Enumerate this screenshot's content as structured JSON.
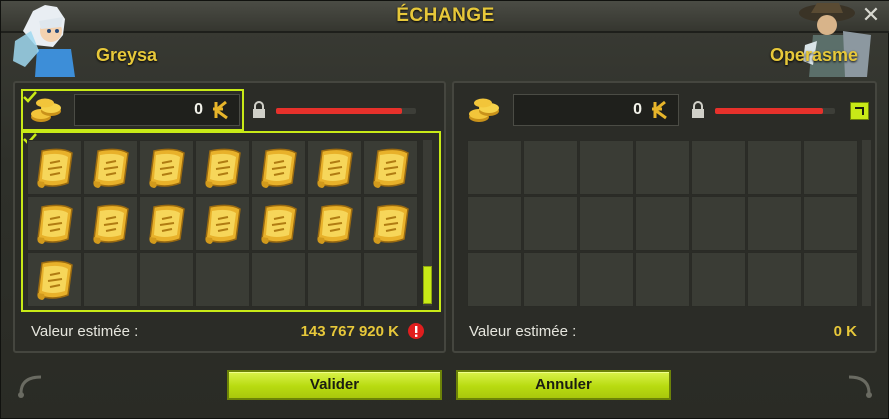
{
  "window": {
    "title": "ÉCHANGE",
    "close_label": "✕"
  },
  "left": {
    "player_name": "Greysa",
    "kamas": "0",
    "lock_progress": 0.9,
    "items": [
      {
        "icon": "scroll-icon"
      },
      {
        "icon": "scroll-icon"
      },
      {
        "icon": "scroll-icon"
      },
      {
        "icon": "scroll-icon"
      },
      {
        "icon": "scroll-icon"
      },
      {
        "icon": "scroll-icon"
      },
      {
        "icon": "scroll-icon"
      },
      {
        "icon": "scroll-icon"
      },
      {
        "icon": "scroll-icon"
      },
      {
        "icon": "scroll-icon"
      },
      {
        "icon": "scroll-icon"
      },
      {
        "icon": "scroll-icon"
      },
      {
        "icon": "scroll-icon"
      },
      {
        "icon": "scroll-icon"
      },
      {
        "icon": "scroll-icon"
      }
    ],
    "value_label": "Valeur estimée :",
    "value_amount": "143 767 920 K"
  },
  "right": {
    "player_name": "Operasme",
    "kamas": "0",
    "lock_progress": 0.9,
    "items": [],
    "value_label": "Valeur estimée :",
    "value_amount": "0 K"
  },
  "buttons": {
    "validate": "Valider",
    "cancel": "Annuler"
  },
  "colors": {
    "accent": "#c8ea17",
    "gold": "#e7c83a",
    "warning": "#e01e1e",
    "bar": "#e7312b"
  }
}
